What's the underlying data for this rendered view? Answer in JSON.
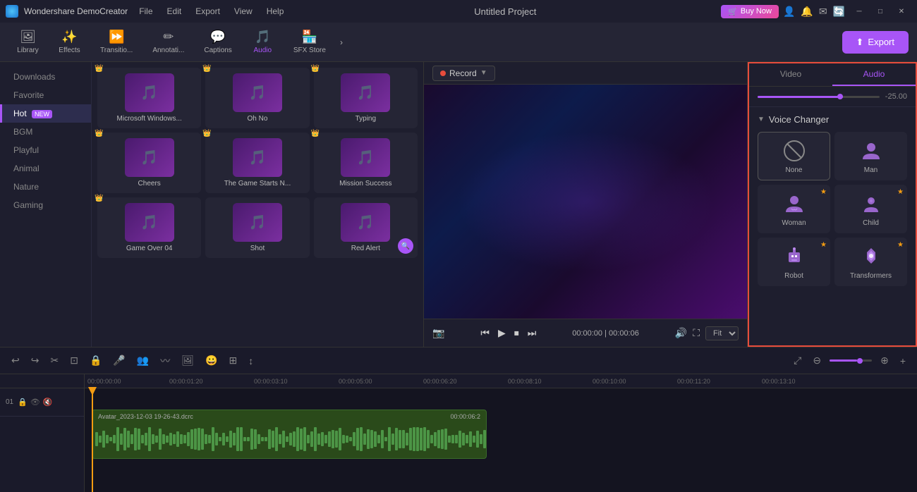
{
  "app": {
    "name": "Wondershare DemoCreator",
    "title": "Untitled Project"
  },
  "titlebar": {
    "menu": [
      "File",
      "Edit",
      "Export",
      "View",
      "Help"
    ],
    "buy_now": "Buy Now",
    "win_controls": [
      "─",
      "□",
      "✕"
    ]
  },
  "toolbar": {
    "items": [
      {
        "id": "library",
        "label": "Library",
        "icon": "🖼"
      },
      {
        "id": "effects",
        "label": "Effects",
        "icon": "✨"
      },
      {
        "id": "transitions",
        "label": "Transitio...",
        "icon": "⏩"
      },
      {
        "id": "annotations",
        "label": "Annotati...",
        "icon": "✏"
      },
      {
        "id": "captions",
        "label": "Captions",
        "icon": "💬"
      },
      {
        "id": "audio",
        "label": "Audio",
        "icon": "🎵"
      },
      {
        "id": "sfx",
        "label": "SFX Store",
        "icon": "🏪"
      }
    ],
    "more": "›",
    "export": "Export"
  },
  "sidebar": {
    "items": [
      {
        "id": "downloads",
        "label": "Downloads",
        "active": false
      },
      {
        "id": "favorite",
        "label": "Favorite",
        "active": false
      },
      {
        "id": "hot",
        "label": "Hot",
        "active": true,
        "badge": "NEW"
      },
      {
        "id": "bgm",
        "label": "BGM",
        "active": false
      },
      {
        "id": "playful",
        "label": "Playful",
        "active": false
      },
      {
        "id": "animal",
        "label": "Animal",
        "active": false
      },
      {
        "id": "nature",
        "label": "Nature",
        "active": false
      },
      {
        "id": "gaming",
        "label": "Gaming",
        "active": false
      }
    ]
  },
  "audio_cards": [
    {
      "name": "Microsoft Windows...",
      "crowned": true,
      "id": "mw"
    },
    {
      "name": "Oh No",
      "crowned": true,
      "id": "on"
    },
    {
      "name": "Typing",
      "crowned": true,
      "id": "ty"
    },
    {
      "name": "Cheers",
      "crowned": true,
      "id": "ch"
    },
    {
      "name": "The Game Starts N...",
      "crowned": true,
      "id": "tg"
    },
    {
      "name": "Mission Success",
      "crowned": true,
      "id": "ms"
    },
    {
      "name": "Game Over 04",
      "crowned": true,
      "id": "go"
    },
    {
      "name": "Shot",
      "crowned": false,
      "id": "sh"
    },
    {
      "name": "Red Alert",
      "crowned": false,
      "id": "ra"
    },
    {
      "name": "",
      "crowned": false,
      "id": "e1"
    },
    {
      "name": "",
      "crowned": false,
      "id": "e2"
    },
    {
      "name": "",
      "crowned": false,
      "id": "e3"
    }
  ],
  "preview": {
    "record_label": "Record",
    "time_left": "00:00:00",
    "time_right": "00:00:06",
    "fit_label": "Fit"
  },
  "right_panel": {
    "tabs": [
      {
        "id": "video",
        "label": "Video"
      },
      {
        "id": "audio",
        "label": "Audio",
        "active": true
      }
    ],
    "volume": "-25.00",
    "voice_changer_title": "Voice Changer",
    "voice_options": [
      {
        "id": "none",
        "label": "None",
        "icon": "⊘",
        "premium": false,
        "selected": true
      },
      {
        "id": "man",
        "label": "Man",
        "icon": "👤",
        "premium": false
      },
      {
        "id": "woman",
        "label": "Woman",
        "icon": "👤",
        "premium": true
      },
      {
        "id": "child",
        "label": "Child",
        "icon": "👤",
        "premium": true
      },
      {
        "id": "robot",
        "label": "Robot",
        "icon": "🤖",
        "premium": true
      },
      {
        "id": "transformers",
        "label": "Transformers",
        "icon": "⚡",
        "premium": true
      }
    ]
  },
  "timeline": {
    "track": {
      "filename": "Avatar_2023-12-03 19-26-43.dcrc",
      "duration": "00:00:06:2"
    },
    "ruler_marks": [
      "00:00:00:00",
      "00:00:01:20",
      "00:00:03:10",
      "00:00:05:00",
      "00:00:06:20",
      "00:00:08:10",
      "00:00:10:00",
      "00:00:11:20",
      "00:00:13:10"
    ]
  },
  "icons": {
    "undo": "↩",
    "redo": "↪",
    "cut": "✂",
    "trim": "⊡",
    "lock": "🔒",
    "mic": "🎤",
    "people": "👥",
    "wave": "〰",
    "image": "🖼",
    "emoji": "😀",
    "split": "⊞",
    "arrow": "↕",
    "zoom_in": "⊕",
    "zoom_out": "⊖",
    "expand": "⤢",
    "plus": "+"
  }
}
